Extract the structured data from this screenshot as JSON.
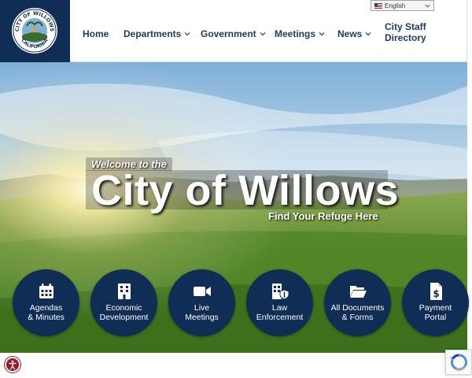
{
  "seal": {
    "top_text": "CITY OF WILLOWS",
    "bottom_text": "CALIFORNIA"
  },
  "nav": {
    "home": "Home",
    "departments": "Departments",
    "government": "Government",
    "meetings": "Meetings",
    "news": "News",
    "staff_line1": "City Staff",
    "staff_line2": "Directory"
  },
  "translate": {
    "language": "English"
  },
  "hero": {
    "welcome": "Welcome to the",
    "title": "City of Willows",
    "tagline": "Find Your Refuge Here"
  },
  "quick_links": [
    {
      "line1": "Agendas",
      "line2": "& Minutes",
      "icon": "calendar-icon"
    },
    {
      "line1": "Economic",
      "line2": "Development",
      "icon": "building-icon"
    },
    {
      "line1": "Live",
      "line2": "Meetings",
      "icon": "video-camera-icon"
    },
    {
      "line1": "Law",
      "line2": "Enforcement",
      "icon": "police-building-shield-icon"
    },
    {
      "line1": "All Documents",
      "line2": "& Forms",
      "icon": "open-folder-icon"
    },
    {
      "line1": "Payment",
      "line2": "Portal",
      "icon": "dollar-document-icon"
    }
  ],
  "colors": {
    "brand_navy": "#0f2d55",
    "nav_text": "#1f3a5f",
    "accessibility_red": "#a0141c"
  }
}
